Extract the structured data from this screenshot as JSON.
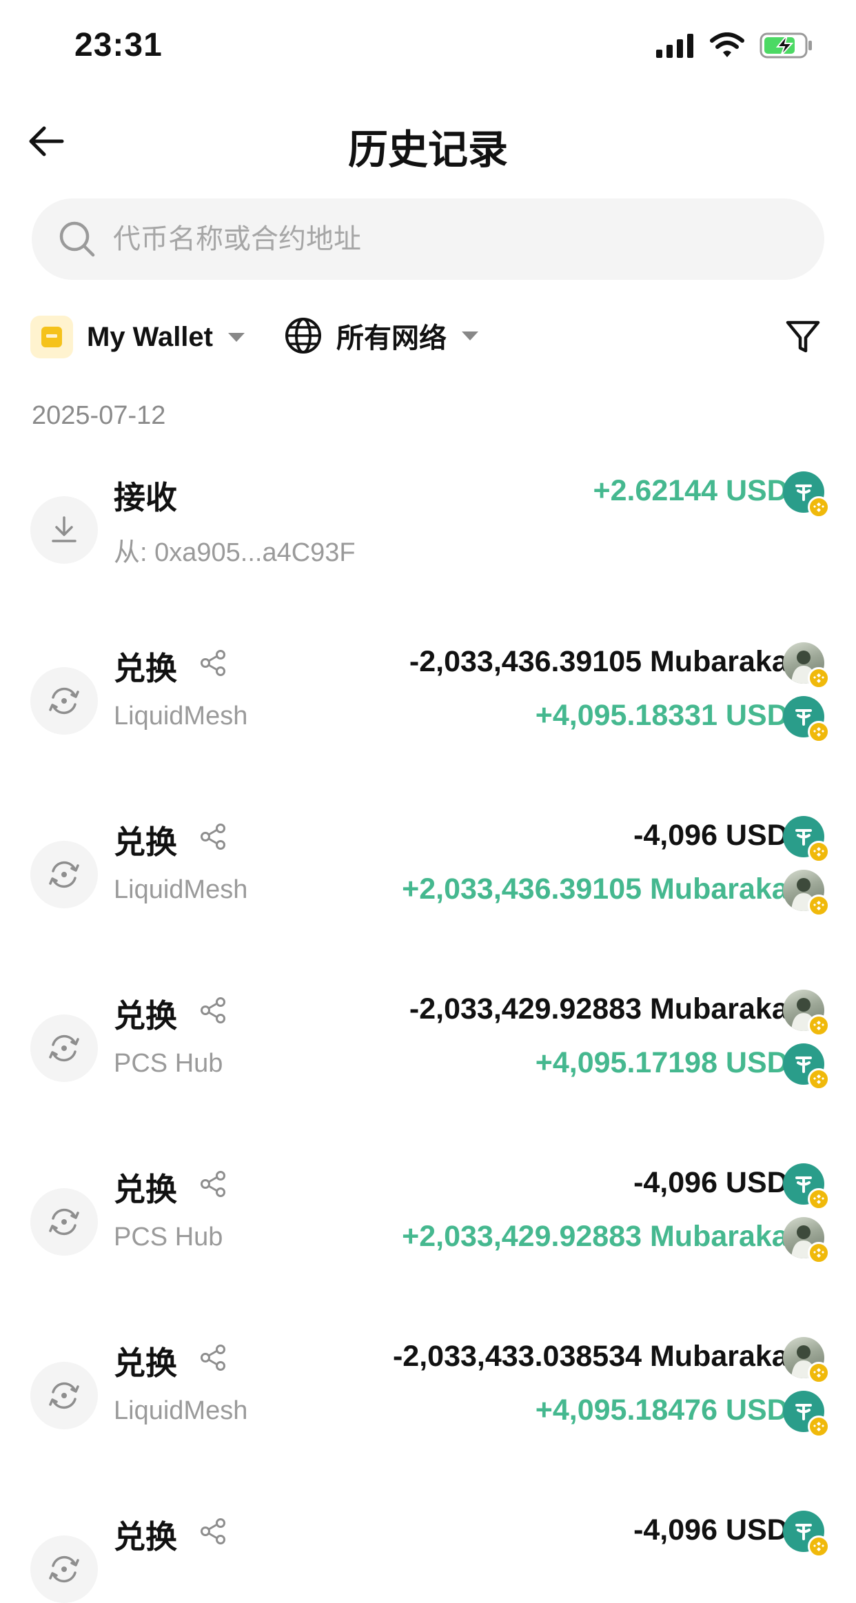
{
  "status_bar": {
    "time": "23:31"
  },
  "header": {
    "title": "历史记录"
  },
  "search": {
    "placeholder": "代币名称或合约地址"
  },
  "filters": {
    "wallet_label": "My Wallet",
    "network_label": "所有网络"
  },
  "date_group": "2025-07-12",
  "colors": {
    "positive": "#45b88f",
    "usdt": "#2a9d8a",
    "bnb": "#f0b90b"
  },
  "transactions": [
    {
      "type": "接收",
      "subtitle": "从: 0xa905...a4C93F",
      "amounts": [
        {
          "text": "+2.62144 USDT",
          "token": "usdt"
        }
      ]
    },
    {
      "type": "兑换",
      "subtitle": "LiquidMesh",
      "amounts": [
        {
          "text": "-2,033,436.39105 Mubarakah",
          "token": "mubarakah"
        },
        {
          "text": "+4,095.18331 USDT",
          "token": "usdt"
        }
      ]
    },
    {
      "type": "兑换",
      "subtitle": "LiquidMesh",
      "amounts": [
        {
          "text": "-4,096 USDT",
          "token": "usdt"
        },
        {
          "text": "+2,033,436.39105 Mubarakah",
          "token": "mubarakah"
        }
      ]
    },
    {
      "type": "兑换",
      "subtitle": "PCS Hub",
      "amounts": [
        {
          "text": "-2,033,429.92883 Mubarakah",
          "token": "mubarakah"
        },
        {
          "text": "+4,095.17198 USDT",
          "token": "usdt"
        }
      ]
    },
    {
      "type": "兑换",
      "subtitle": "PCS Hub",
      "amounts": [
        {
          "text": "-4,096 USDT",
          "token": "usdt"
        },
        {
          "text": "+2,033,429.92883 Mubarakah",
          "token": "mubarakah"
        }
      ]
    },
    {
      "type": "兑换",
      "subtitle": "LiquidMesh",
      "amounts": [
        {
          "text": "-2,033,433.038534 Mubarakah",
          "token": "mubarakah"
        },
        {
          "text": "+4,095.18476 USDT",
          "token": "usdt"
        }
      ]
    },
    {
      "type": "兑换",
      "subtitle": "",
      "amounts": [
        {
          "text": "-4,096 USDT",
          "token": "usdt"
        }
      ]
    }
  ]
}
